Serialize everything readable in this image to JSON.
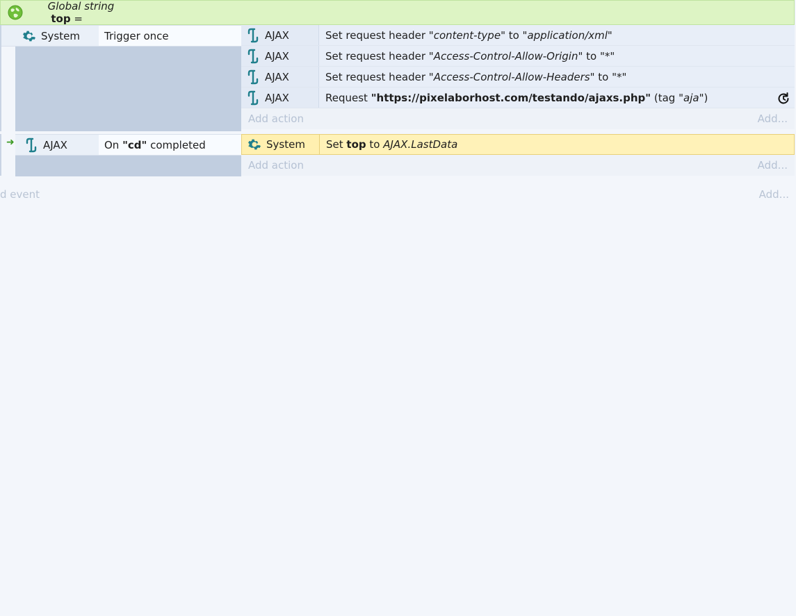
{
  "global_var": {
    "prefix": "Global string",
    "name": "top",
    "suffix": " ="
  },
  "event1": {
    "condition": {
      "object": "System",
      "text": "Trigger once"
    },
    "actions": [
      {
        "object": "AJAX",
        "parts": [
          "Set request header \"",
          "content-type",
          "\" to \"",
          "application/xml",
          "\""
        ]
      },
      {
        "object": "AJAX",
        "parts": [
          "Set request header \"",
          "Access-Control-Allow-Origin",
          "\" to \"*\""
        ]
      },
      {
        "object": "AJAX",
        "parts": [
          "Set request header \"",
          "Access-Control-Allow-Headers",
          "\" to \"*\""
        ]
      },
      {
        "object": "AJAX",
        "parts": [
          "Request ",
          "\"https://pixelaborhost.com/testando/ajaxs.php\"",
          " (tag \"",
          "aja",
          "\")"
        ]
      }
    ],
    "add_action": "Add action",
    "add": "Add..."
  },
  "event2": {
    "condition": {
      "object": "AJAX",
      "pre": "On ",
      "tag": "\"cd\"",
      "post": " completed"
    },
    "actions": [
      {
        "object": "System",
        "pre": "Set ",
        "var": "top",
        "mid": " to ",
        "expr": "AJAX.LastData"
      }
    ],
    "add_action": "Add action",
    "add": "Add..."
  },
  "footer": {
    "add_event": "d event",
    "add": "Add..."
  },
  "colors": {
    "global_bg": "#ddf4c4",
    "highlight": "#fff2b8",
    "icon_teal": "#1f7f8c"
  }
}
